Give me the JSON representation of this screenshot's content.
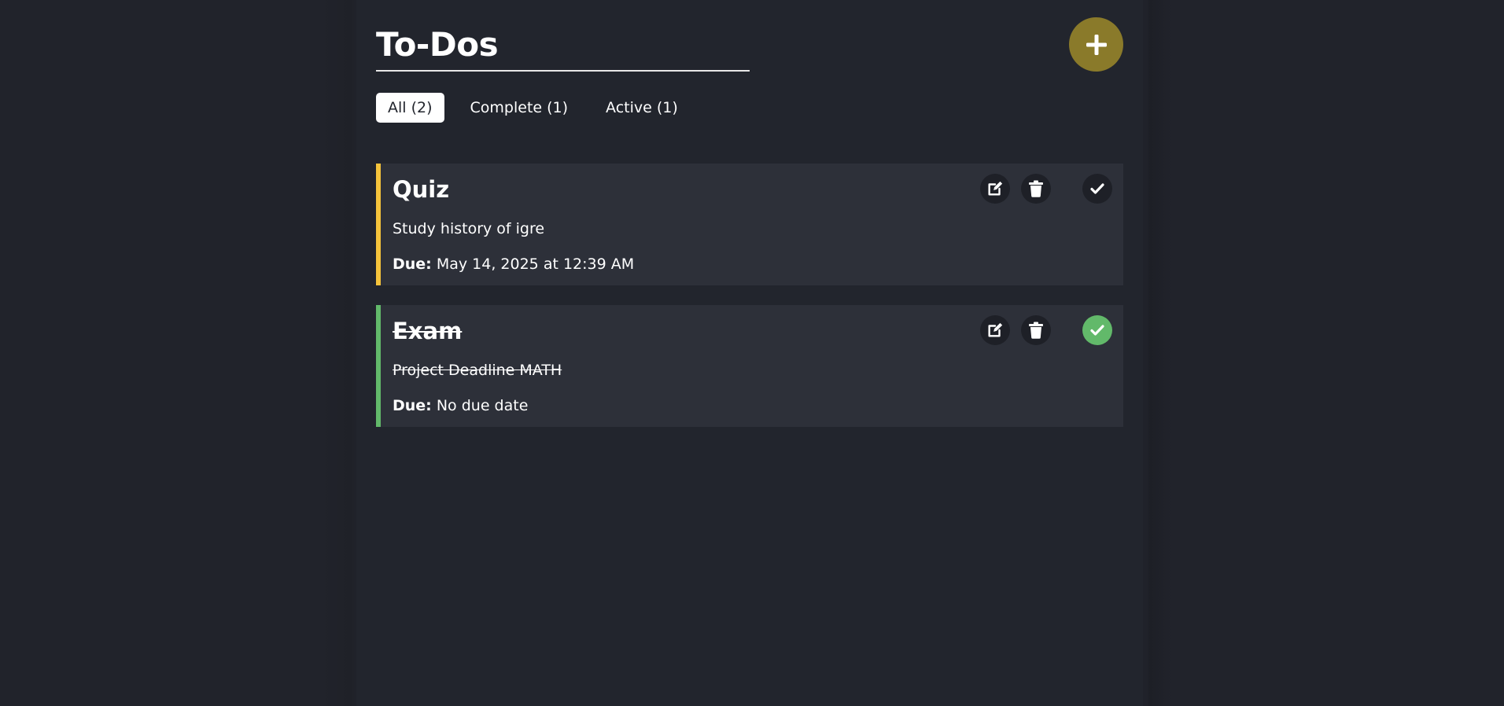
{
  "header": {
    "title": "To-Dos",
    "add_icon": "plus-icon"
  },
  "filters": [
    {
      "label": "All (2)",
      "active": true
    },
    {
      "label": "Complete (1)",
      "active": false
    },
    {
      "label": "Active (1)",
      "active": false
    }
  ],
  "todos": [
    {
      "title": "Quiz",
      "description": "Study history of igre",
      "due_label": "Due:",
      "due_value": "May 14, 2025 at 12:39 AM",
      "completed": false,
      "accent_color": "#f5c33b"
    },
    {
      "title": "Exam",
      "description": "Project Deadline MATH",
      "due_label": "Due:",
      "due_value": "No due date",
      "completed": true,
      "accent_color": "#62b96a"
    }
  ],
  "icons": {
    "edit": "edit-icon",
    "delete": "trash-icon",
    "check": "check-icon"
  },
  "colors": {
    "background": "#21232b",
    "card": "#2d3039",
    "add_button": "#8a7a2a",
    "complete": "#62b96a",
    "active_accent": "#f5c33b"
  }
}
